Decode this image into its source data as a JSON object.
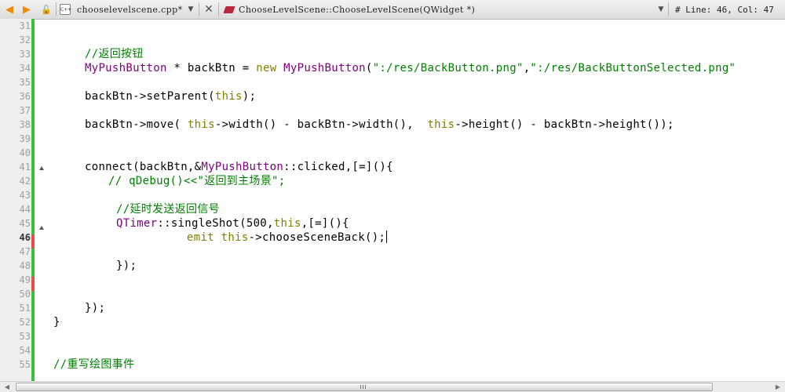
{
  "toolbar": {
    "file_tab": "chooselevelscene.cpp*",
    "symbol": "ChooseLevelScene::ChooseLevelScene(QWidget *)",
    "position": "#  Line: 46, Col: 47",
    "file_icon_text": "C++",
    "icons": [
      "back-arrow-icon",
      "forward-arrow-icon",
      "lock-icon",
      "cpp-file-icon",
      "chevron-down-icon",
      "close-icon",
      "method-icon"
    ]
  },
  "editor": {
    "current_line": 46,
    "modified_lines": [
      46,
      49
    ],
    "fold_markers": [
      41,
      45
    ],
    "line_numbers": [
      "31",
      "32",
      "33",
      "34",
      "35",
      "36",
      "37",
      "38",
      "39",
      "40",
      "41",
      "42",
      "43",
      "44",
      "45",
      "46",
      "47",
      "48",
      "49",
      "50",
      "51",
      "52",
      "53",
      "54",
      "55"
    ],
    "lines": {
      "l33": {
        "comment": "//返回按钮"
      },
      "l34": {
        "t1": "MyPushButton",
        "t2": " * backBtn = ",
        "t3": "new",
        "t4": " ",
        "t5": "MyPushButton",
        "t6": "(",
        "t7": "\":/res/BackButton.png\"",
        "t8": ",",
        "t9": "\":/res/BackButtonSelected.png\""
      },
      "l36": {
        "t1": "backBtn->setParent(",
        "t2": "this",
        "t3": ");"
      },
      "l38": {
        "t1": "backBtn->move( ",
        "t2": "this",
        "t3": "->width() - backBtn->width(),  ",
        "t4": "this",
        "t5": "->height() - backBtn->height());"
      },
      "l41": {
        "t1": "connect(backBtn,&",
        "t2": "MyPushButton",
        "t3": "::clicked,[=](){"
      },
      "l42": {
        "comment": "// qDebug()<<\"返回到主场景\";"
      },
      "l44": {
        "comment": "//延时发送返回信号"
      },
      "l45": {
        "t1": "QTimer",
        "t2": "::singleShot(500,",
        "t3": "this",
        "t4": ",[=](){"
      },
      "l46": {
        "t1": "emit",
        "t2": " ",
        "t3": "this",
        "t4": "->chooseSceneBack();"
      },
      "l48": {
        "t1": "});"
      },
      "l51": {
        "t1": "});"
      },
      "l52": {
        "t1": "}"
      },
      "l55": {
        "comment": "//重写绘图事件"
      }
    }
  },
  "colors": {
    "comment": "#008000",
    "keyword": "#808000",
    "type": "#800080",
    "string": "#008000",
    "modified_marker": "#3cbf3c",
    "unsaved_marker": "#e05050"
  },
  "scrollbar": {
    "grip_icon": "grip-icon"
  }
}
